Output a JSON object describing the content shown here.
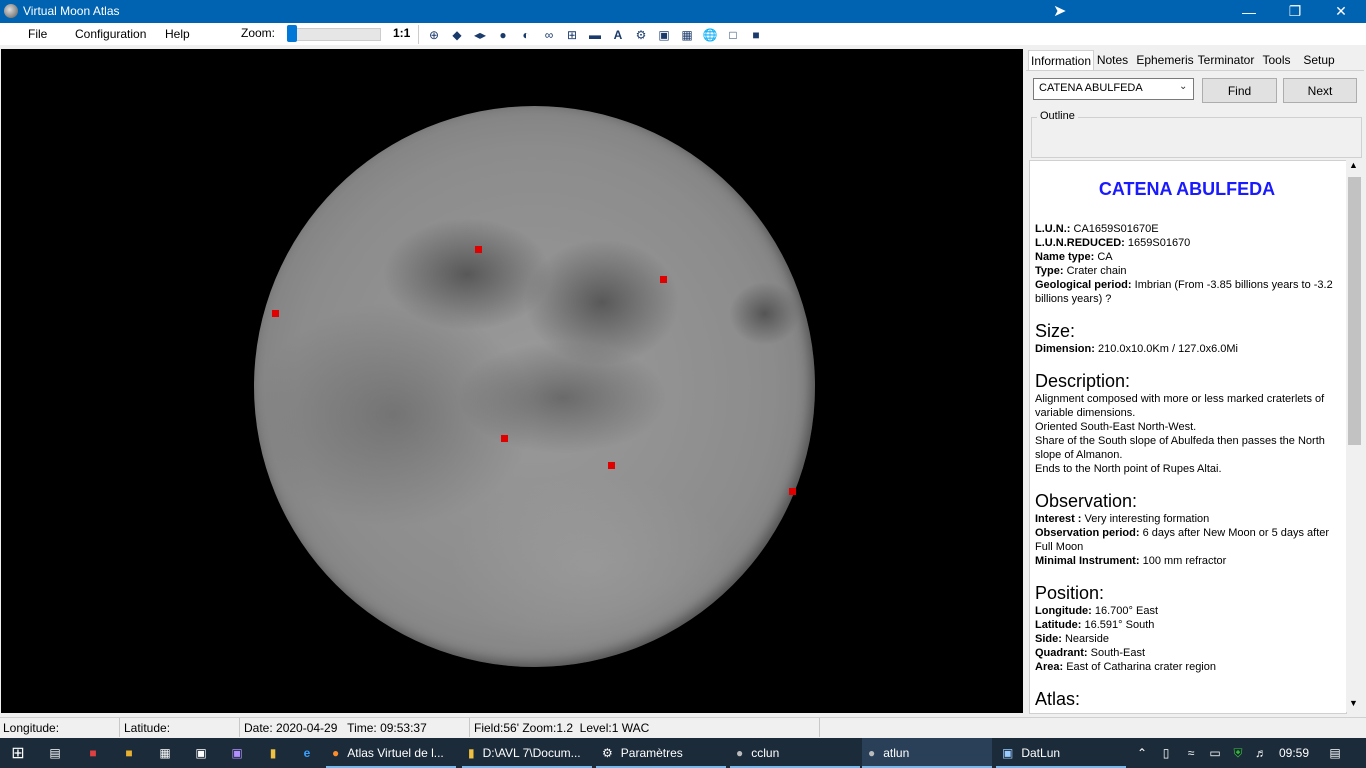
{
  "window": {
    "title": "Virtual Moon Atlas"
  },
  "menu": [
    "File",
    "Configuration",
    "Help"
  ],
  "toolbar": {
    "zoom_label": "Zoom:",
    "zoom_value": 0.0,
    "one_to_one": "1:1"
  },
  "tabs": [
    "Information",
    "Notes",
    "Ephemeris",
    "Terminator",
    "Tools",
    "Setup"
  ],
  "search": {
    "value": "CATENA ABULFEDA",
    "find": "Find",
    "next": "Next",
    "outline": "Outline"
  },
  "info": {
    "title": "CATENA ABULFEDA",
    "lun_label": "L.U.N.:",
    "lun": "CA1659S01670E",
    "lunr_label": "L.U.N.REDUCED:",
    "lunr": "1659S01670",
    "nametype_label": "Name type:",
    "nametype": "CA",
    "type_label": "Type:",
    "type": "Crater chain",
    "geo_label": "Geological period:",
    "geo": "Imbrian (From -3.85 billions years to -3.2 billions years) ?",
    "size_h": "Size:",
    "dim_label": "Dimension:",
    "dim": "210.0x10.0Km / 127.0x6.0Mi",
    "desc_h": "Description:",
    "desc1": "Alignment composed with more or less marked craterlets of variable dimensions.",
    "desc2": "Oriented South-East North-West.",
    "desc3": "Share of the South slope of Abulfeda then passes the North slope of Almanon.",
    "desc4": "Ends to the North point of Rupes Altai.",
    "obs_h": "Observation:",
    "interest_label": "Interest :",
    "interest": "Very interesting formation",
    "period_label": "Observation period:",
    "period": "6 days after New Moon or 5 days after Full Moon",
    "instr_label": "Minimal Instrument:",
    "instr": "100 mm refractor",
    "pos_h": "Position:",
    "lon_label": "Longitude:",
    "lon": "16.700° East",
    "lat_label": "Latitude:",
    "lat": "16.591° South",
    "side_label": "Side:",
    "side": "Nearside",
    "quad_label": "Quadrant:",
    "quad": "South-East",
    "area_label": "Area:",
    "area": "East of Catharina crater region",
    "atlas_h": "Atlas:"
  },
  "status": {
    "longitude": "Longitude:",
    "latitude": "Latitude:",
    "datetime": "Date: 2020-04-29   Time: 09:53:37",
    "field": "Field:56' Zoom:1.2  Level:1 WAC"
  },
  "taskbar": {
    "tasks": [
      "Atlas Virtuel de l...",
      "D:\\AVL 7\\Docum...",
      "Paramètres",
      "cclun",
      "atlun",
      "DatLun"
    ],
    "clock": "09:59"
  },
  "colors": {
    "accent": "#0063b1",
    "title_blue": "#1a1aff",
    "marker": "#e00000"
  }
}
